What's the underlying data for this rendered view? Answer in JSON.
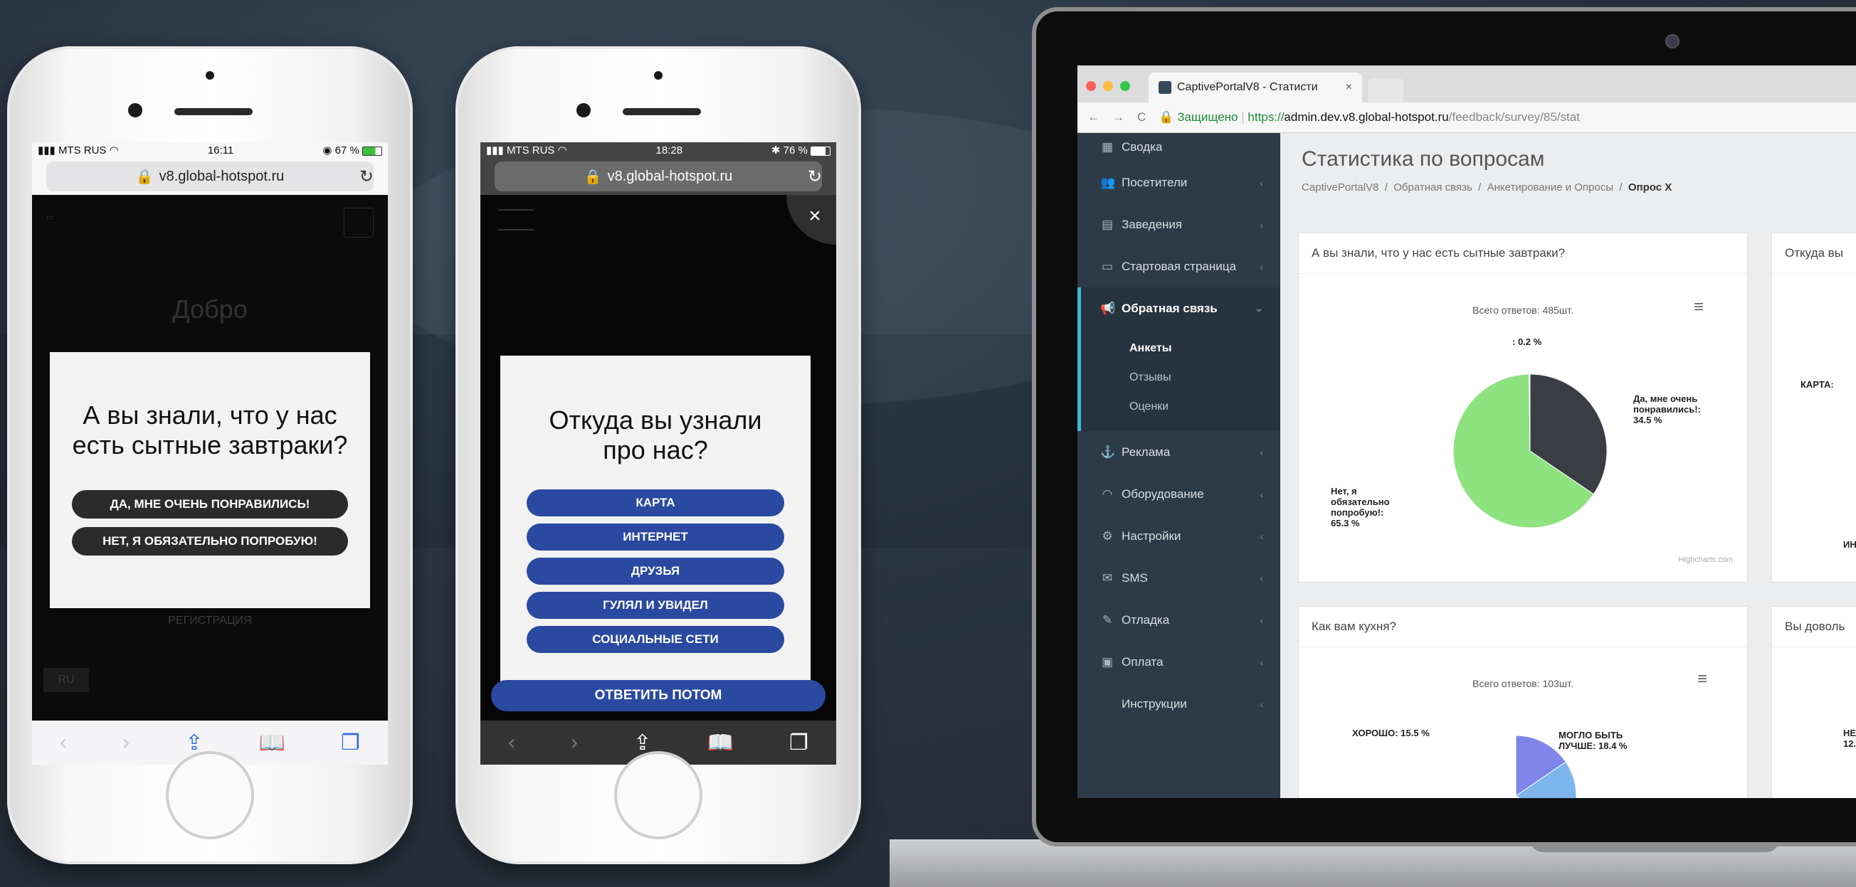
{
  "phone1": {
    "carrier": "MTS RUS",
    "time": "16:11",
    "battery": "67 %",
    "url": "v8.global-hotspot.ru",
    "bg_text": {
      "welcome": "Добро",
      "register": "РЕГИСТРАЦИЯ",
      "lang": "RU"
    },
    "modal": {
      "question": "А вы знали, что у нас есть сытные завтраки?",
      "options": [
        "ДА, МНЕ ОЧЕНЬ ПОНРАВИЛИСЬ!",
        "НЕТ, Я ОБЯЗАТЕЛЬНО ПОПРОБУЮ!"
      ]
    }
  },
  "phone2": {
    "carrier": "MTS RUS",
    "time": "18:28",
    "battery": "76 %",
    "url": "v8.global-hotspot.ru",
    "close": "×",
    "modal": {
      "question": "Откуда вы узнали про нас?",
      "options": [
        "КАРТА",
        "ИНТЕРНЕТ",
        "ДРУЗЬЯ",
        "ГУЛЯЛ И УВИДЕЛ",
        "СОЦИАЛЬНЫЕ СЕТИ"
      ]
    },
    "answer_later": "ОТВЕТИТЬ ПОТОМ"
  },
  "browser": {
    "tab_title": "CaptivePortalV8 - Статисти",
    "tab_close": "×",
    "secure": "Защищено",
    "url_scheme": "https://",
    "url_host": "admin.dev.v8.global-hotspot.ru",
    "url_path": "/feedback/survey/85/stat"
  },
  "sidebar": {
    "items": [
      {
        "icon": "dashboard-icon",
        "label": "Сводка"
      },
      {
        "icon": "users-icon",
        "label": "Посетители"
      },
      {
        "icon": "building-icon",
        "label": "Заведения"
      },
      {
        "icon": "monitor-icon",
        "label": "Стартовая страница"
      },
      {
        "icon": "megaphone-icon",
        "label": "Обратная связь"
      },
      {
        "icon": "anchor-icon",
        "label": "Реклама"
      },
      {
        "icon": "wifi-icon",
        "label": "Оборудование"
      },
      {
        "icon": "gears-icon",
        "label": "Настройки"
      },
      {
        "icon": "envelope-icon",
        "label": "SMS"
      },
      {
        "icon": "bug-icon",
        "label": "Отладка"
      },
      {
        "icon": "card-icon",
        "label": "Оплата"
      },
      {
        "icon": "",
        "label": "Инструкции"
      }
    ],
    "submenu": [
      "Анкеты",
      "Отзывы",
      "Оценки"
    ]
  },
  "page": {
    "title": "Статистика по вопросам",
    "breadcrumbs": [
      "CaptivePortalV8",
      "Обратная связь",
      "Анкетирование и Опросы",
      "Опрос X"
    ]
  },
  "cards": [
    {
      "title": "А вы знали, что у нас есть сытные завтраки?",
      "total": "Всего ответов: 485шт.",
      "credit": "Highcharts.com"
    },
    {
      "title": "Откуда вы"
    },
    {
      "title": "Как вам кухня?",
      "total": "Всего ответов: 103шт."
    },
    {
      "title": "Вы доволь"
    }
  ],
  "chart_data": [
    {
      "type": "pie",
      "title": "А вы знали, что у нас есть сытные завтраки?",
      "subtitle": "Всего ответов: 485шт.",
      "categories": [
        "Да, мне очень понравились!",
        "Нет, я обязательно попробую!",
        ""
      ],
      "values": [
        34.5,
        65.3,
        0.2
      ],
      "labels": [
        "Да, мне очень понравились!: 34.5 %",
        "Нет, я обязательно попробую!: 65.3 %",
        ": 0.2 %"
      ],
      "colors": [
        "#3a3d44",
        "#8ee27f",
        "#7cb5ec"
      ]
    },
    {
      "type": "pie",
      "title": "Как вам кухня?",
      "subtitle": "Всего ответов: 103шт.",
      "categories": [
        "ХОРОШО",
        "МОГЛО БЫТЬ ЛУЧШЕ"
      ],
      "values": [
        15.5,
        18.4
      ],
      "labels": [
        "ХОРОШО: 15.5 %",
        "МОГЛО БЫТЬ ЛУЧШЕ: 18.4 %"
      ],
      "colors": [
        "#8085e9",
        "#7cb5ec",
        "#f7a35c"
      ]
    }
  ],
  "right_cut_labels": [
    "КАРТА:",
    "ИНТЕР",
    "НЕ",
    "12."
  ]
}
